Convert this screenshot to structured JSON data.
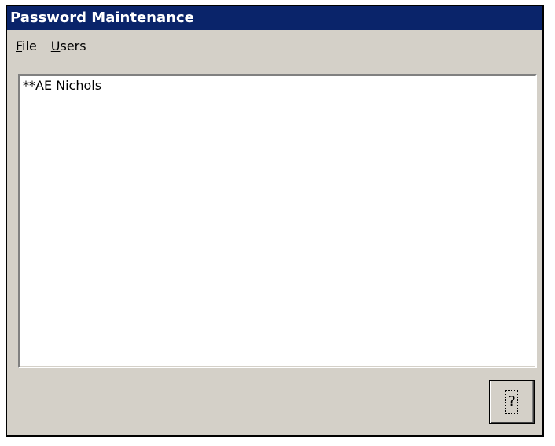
{
  "window": {
    "title": "Password Maintenance"
  },
  "menu": {
    "items": [
      {
        "accel": "F",
        "rest": "ile"
      },
      {
        "accel": "U",
        "rest": "sers"
      }
    ]
  },
  "users_list": {
    "items": [
      "**AE Nichols"
    ]
  },
  "help_button": {
    "label": "?"
  },
  "colors": {
    "titlebar": "#0a246a",
    "face": "#d4d0c8"
  }
}
